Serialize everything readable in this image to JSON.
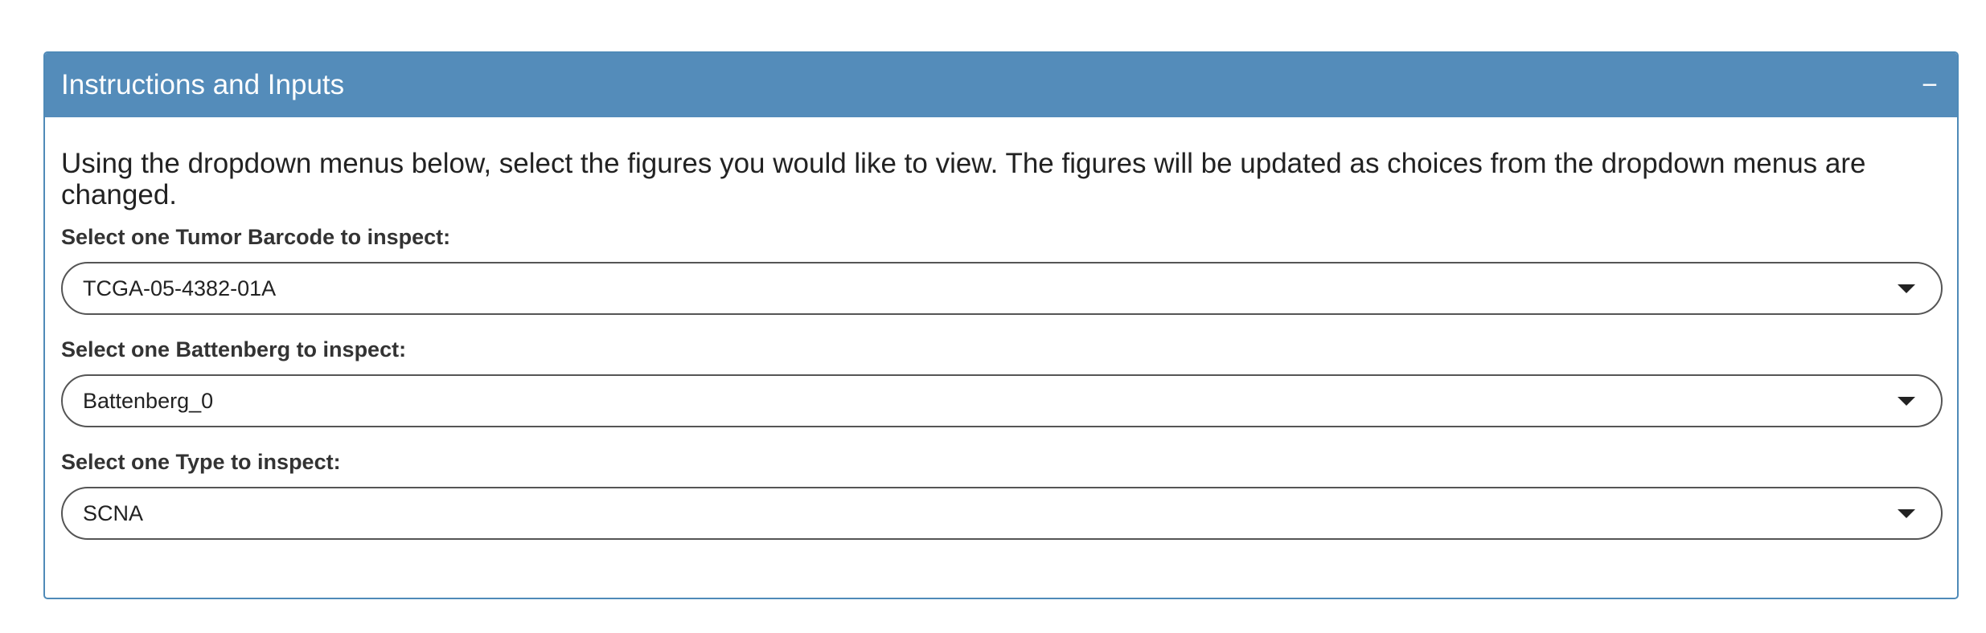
{
  "panel": {
    "title": "Instructions and Inputs",
    "collapse_symbol": "−"
  },
  "instructions": "Using the dropdown menus below, select the figures you would like to view. The figures will be updated as choices from the dropdown menus are changed.",
  "fields": [
    {
      "label": "Select one Tumor Barcode to inspect:",
      "value": "TCGA-05-4382-01A"
    },
    {
      "label": "Select one Battenberg to inspect:",
      "value": "Battenberg_0"
    },
    {
      "label": "Select one Type to inspect:",
      "value": "SCNA"
    }
  ],
  "colors": {
    "header_bg": "#548cba",
    "border": "#4f8ab8"
  },
  "icons": {
    "collapse": "minus-icon",
    "dropdown": "chevron-down-icon"
  }
}
